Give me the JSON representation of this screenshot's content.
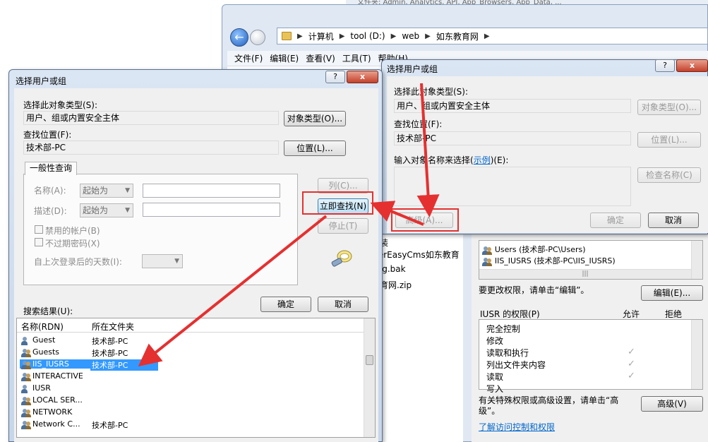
{
  "explorer": {
    "top_strip": "文件夹: Admin, Analytics, API, App_Browsers, App_Data, ...",
    "breadcrumbs": [
      "计算机",
      "tool (D:)",
      "web",
      "如东教育网"
    ],
    "menu": [
      "文件(F)",
      "编辑(E)",
      "查看(V)",
      "工具(T)",
      "帮助(H)"
    ],
    "files": [
      "安装",
      "werEasyCms如东教育",
      "png.bak",
      "教育网.zip"
    ]
  },
  "props": {
    "users": [
      "Users (技术部-PC\\Users)",
      "IIS_IUSRS (技术部-PC\\IIS_IUSRS)"
    ],
    "change_hint": "要更改权限，请单击“编辑”。",
    "edit_button": "编辑(E)...",
    "perm_title": "IUSR 的权限(P)",
    "allow_label": "允许",
    "deny_label": "拒绝",
    "permissions": [
      {
        "name": "完全控制",
        "allow": false
      },
      {
        "name": "修改",
        "allow": false
      },
      {
        "name": "读取和执行",
        "allow": true
      },
      {
        "name": "列出文件夹内容",
        "allow": true
      },
      {
        "name": "读取",
        "allow": true
      },
      {
        "name": "写入",
        "allow": false
      }
    ],
    "advanced_hint": "有关特殊权限或高级设置，请单击“高级”。",
    "advanced_button": "高级(V)",
    "learn_link": "了解访问控制和权限"
  },
  "simple_dialog": {
    "title": "选择用户或组",
    "help": "?",
    "close": "x",
    "object_type_label": "选择此对象类型(S):",
    "object_type_value": "用户、组或内置安全主体",
    "object_type_button": "对象类型(O)...",
    "location_label": "查找位置(F):",
    "location_value": "技术部-PC",
    "location_button": "位置(L)...",
    "enter_label_1": "输入对象",
    "enter_label_2": "名称来选择(",
    "example_link": "示例",
    "enter_label_3": ")(E):",
    "check_names_button": "检查名称(C)",
    "advanced_button": "高级(A)...",
    "ok_button": "确定",
    "cancel_button": "取消"
  },
  "adv_dialog": {
    "title": "选择用户或组",
    "help": "?",
    "close": "x",
    "object_type_label": "选择此对象类型(S):",
    "object_type_value": "用户、组或内置安全主体",
    "object_type_button": "对象类型(O)...",
    "location_label": "查找位置(F):",
    "location_value": "技术部-PC",
    "location_button": "位置(L)...",
    "tab_label": "一般性查询",
    "name_label": "名称(A):",
    "desc_label": "描述(D):",
    "starts_with": "起始为",
    "disabled_accounts": "禁用的帐户(B)",
    "non_expiring": "不过期密码(X)",
    "days_label": "自上次登录后的天数(I):",
    "columns_button": "列(C)...",
    "find_now_button": "立即查找(N)",
    "stop_button": "停止(T)",
    "ok_button": "确定",
    "cancel_button": "取消",
    "results_label": "搜索结果(U):",
    "col_name": "名称(RDN)",
    "col_folder": "所在文件夹",
    "results": [
      {
        "name": "Guest",
        "folder": "技术部-PC"
      },
      {
        "name": "Guests",
        "folder": "技术部-PC"
      },
      {
        "name": "IIS_IUSRS",
        "folder": "技术部-PC"
      },
      {
        "name": "INTERACTIVE",
        "folder": ""
      },
      {
        "name": "IUSR",
        "folder": ""
      },
      {
        "name": "LOCAL SER...",
        "folder": ""
      },
      {
        "name": "NETWORK",
        "folder": ""
      },
      {
        "name": "Network C...",
        "folder": "技术部-PC"
      }
    ]
  }
}
